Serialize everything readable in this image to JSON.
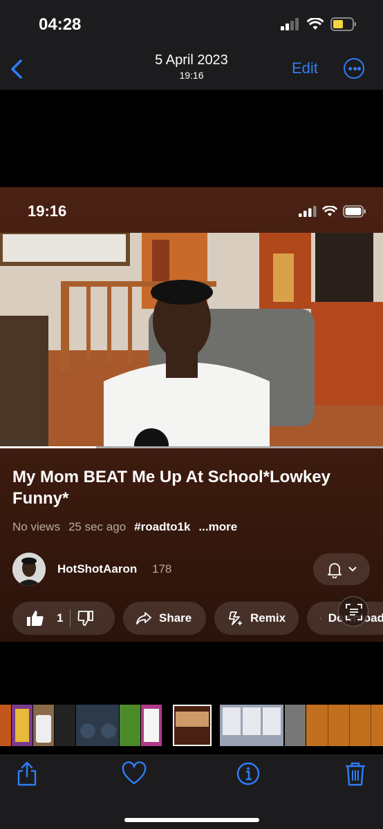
{
  "status_bar": {
    "time": "04:28"
  },
  "nav": {
    "date": "5 April 2023",
    "time": "19:16",
    "edit_label": "Edit"
  },
  "screenshot": {
    "status_time": "19:16",
    "video": {
      "title": "My Mom BEAT Me Up At School*Lowkey Funny*",
      "views": "No views",
      "age": "25 sec ago",
      "hashtag": "#roadto1k",
      "more_label": "...more",
      "progress_fraction": 0.25
    },
    "channel": {
      "name": "HotShotAaron",
      "subscribers": "178"
    },
    "actions": {
      "likes": "1",
      "share_label": "Share",
      "remix_label": "Remix",
      "download_label": "Download"
    }
  },
  "icons": {
    "back": "chevron-left-icon",
    "more": "ellipsis-circle-icon",
    "share": "share-icon",
    "favorite": "heart-icon",
    "info": "info-icon",
    "delete": "trash-icon"
  },
  "colors": {
    "accent": "#2f7df6",
    "battery": "#f5d63d",
    "bar": "#1c1c1e"
  }
}
